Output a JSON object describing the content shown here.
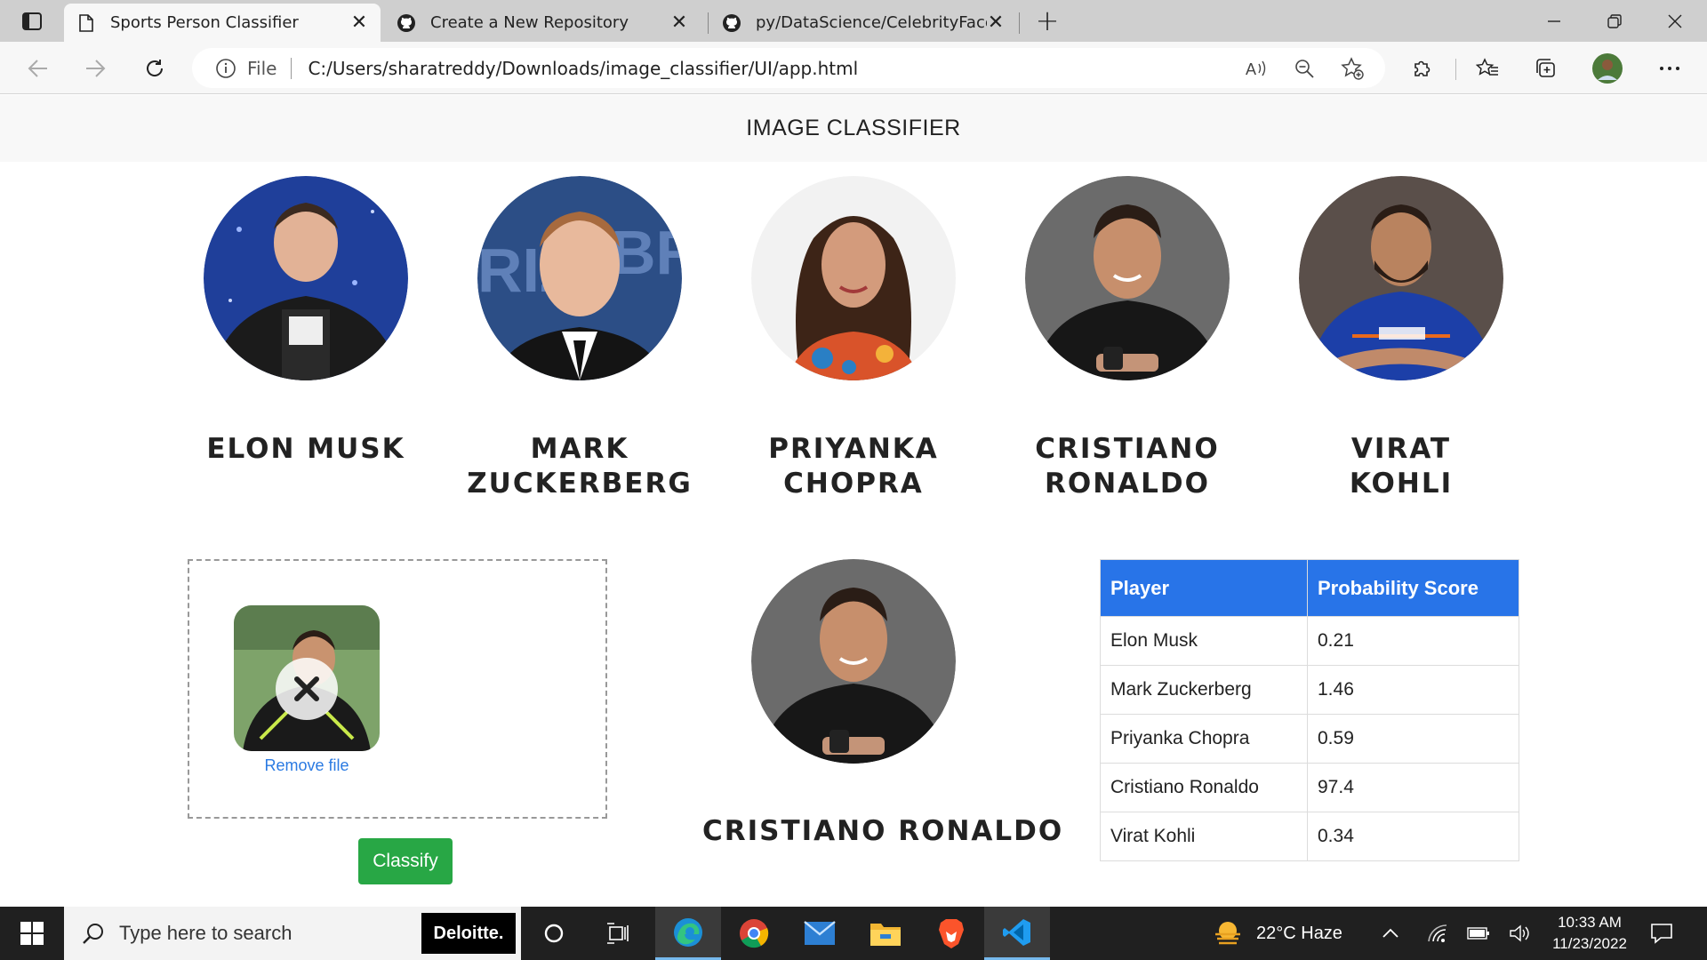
{
  "browser": {
    "tabs": [
      {
        "title": "Sports Person Classifier",
        "icon": "document-icon",
        "active": true
      },
      {
        "title": "Create a New Repository",
        "icon": "github-icon",
        "active": false
      },
      {
        "title": "py/DataScience/CelebrityFaceRe",
        "icon": "github-icon",
        "active": false
      }
    ],
    "new_tab_label": "+",
    "close_glyph": "✕",
    "address": {
      "scheme_label": "File",
      "url": "C:/Users/sharatreddy/Downloads/image_classifier/UI/app.html"
    }
  },
  "page": {
    "navbar_title": "IMAGE CLASSIFIER",
    "people": [
      {
        "name": "ELON MUSK"
      },
      {
        "name": "MARK ZUCKERBERG"
      },
      {
        "name": "PRIYANKA CHOPRA"
      },
      {
        "name": "CRISTIANO RONALDO"
      },
      {
        "name": "VIRAT KOHLI"
      }
    ],
    "dropzone": {
      "remove_label": "Remove file"
    },
    "classify_label": "Classify",
    "result_name": "CRISTIANO RONALDO",
    "table": {
      "headers": [
        "Player",
        "Probability Score"
      ],
      "rows": [
        [
          "Elon Musk",
          "0.21"
        ],
        [
          "Mark Zuckerberg",
          "1.46"
        ],
        [
          "Priyanka Chopra",
          "0.59"
        ],
        [
          "Cristiano Ronaldo",
          "97.4"
        ],
        [
          "Virat Kohli",
          "0.34"
        ]
      ]
    },
    "colors": {
      "table_header": "#2874e8",
      "classify_button": "#28a745",
      "link": "#2a7ae2"
    }
  },
  "taskbar": {
    "search_placeholder": "Type here to search",
    "search_badge": "Deloitte.",
    "weather": "22°C  Haze",
    "time": "10:33 AM",
    "date": "11/23/2022",
    "apps": [
      "cortana-icon",
      "task-view-icon",
      "edge-icon",
      "chrome-icon",
      "mail-icon",
      "file-explorer-icon",
      "brave-icon",
      "vscode-icon"
    ]
  }
}
